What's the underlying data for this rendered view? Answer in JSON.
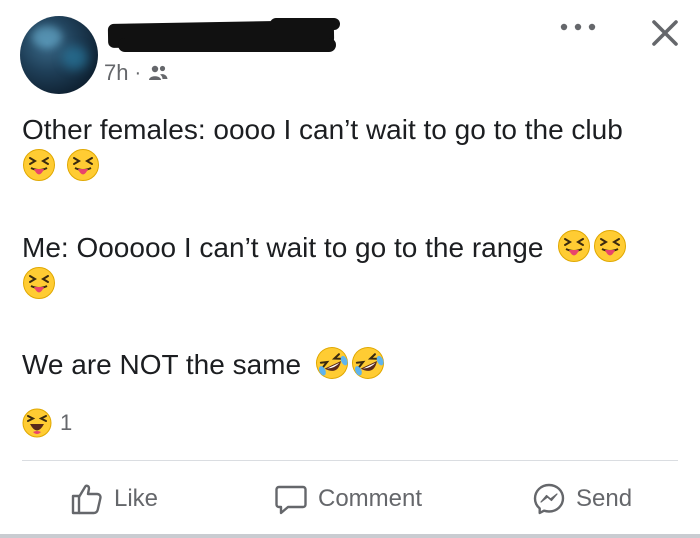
{
  "post": {
    "time": "7h",
    "separator": "·",
    "audience_icon": "friends-icon",
    "paragraphs": [
      {
        "text": "Other females: oooo I can’t wait to go to the club",
        "emojis": [
          "squinting-tongue-emoji",
          "squinting-tongue-emoji"
        ]
      },
      {
        "text": "Me: Oooooo I can’t wait to go to the range",
        "emojis": [
          "squinting-tongue-emoji",
          "squinting-tongue-emoji",
          "squinting-tongue-emoji"
        ]
      },
      {
        "text": "We are NOT the same",
        "emojis": [
          "rolling-laughing-emoji",
          "rolling-laughing-emoji"
        ]
      }
    ]
  },
  "reactions": {
    "icon": "haha-reaction-icon",
    "count": "1"
  },
  "actions": {
    "like_label": "Like",
    "comment_label": "Comment",
    "send_label": "Send"
  },
  "colors": {
    "text": "#1c1e21",
    "secondary_text": "#65676b",
    "emoji_yellow": "#ffcc33",
    "divider": "#dadde1"
  }
}
